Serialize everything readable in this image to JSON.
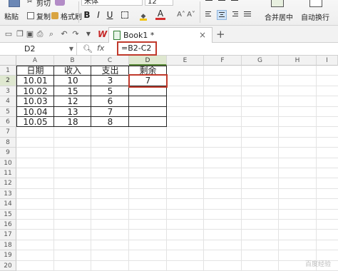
{
  "ribbon": {
    "paste_label": "粘贴",
    "cut_label": "剪切",
    "copy_label": "复制",
    "format_painter_label": "格式刷",
    "font_name": "宋体",
    "font_size": "12",
    "bold": "B",
    "italic": "I",
    "underline": "U",
    "font_color": "A",
    "merge_label": "合并居中",
    "wrap_label": "自动换行"
  },
  "tabs": {
    "app_logo": "W",
    "doc_title": "Book1 *",
    "close": "×",
    "new_tab": "+"
  },
  "formula_bar": {
    "cell_ref": "D2",
    "fx_label": "fx",
    "formula": "=B2-C2"
  },
  "columns": [
    "A",
    "B",
    "C",
    "D",
    "E",
    "F",
    "G",
    "H",
    "I"
  ],
  "rows": [
    "1",
    "2",
    "3",
    "4",
    "5",
    "6",
    "7",
    "8",
    "9",
    "10",
    "11",
    "12",
    "13",
    "14",
    "15",
    "16",
    "17",
    "18",
    "19",
    "20"
  ],
  "table": {
    "headers": [
      "日期",
      "收入",
      "支出",
      "剩余"
    ],
    "rows": [
      [
        "10.01",
        "10",
        "3",
        "7"
      ],
      [
        "10.02",
        "15",
        "5",
        ""
      ],
      [
        "10.03",
        "12",
        "6",
        ""
      ],
      [
        "10.04",
        "13",
        "7",
        ""
      ],
      [
        "10.05",
        "18",
        "8",
        ""
      ]
    ]
  },
  "watermark": "百度经验",
  "colors": {
    "highlight": "#c0392b",
    "selected_header": "#dfe8d0"
  }
}
